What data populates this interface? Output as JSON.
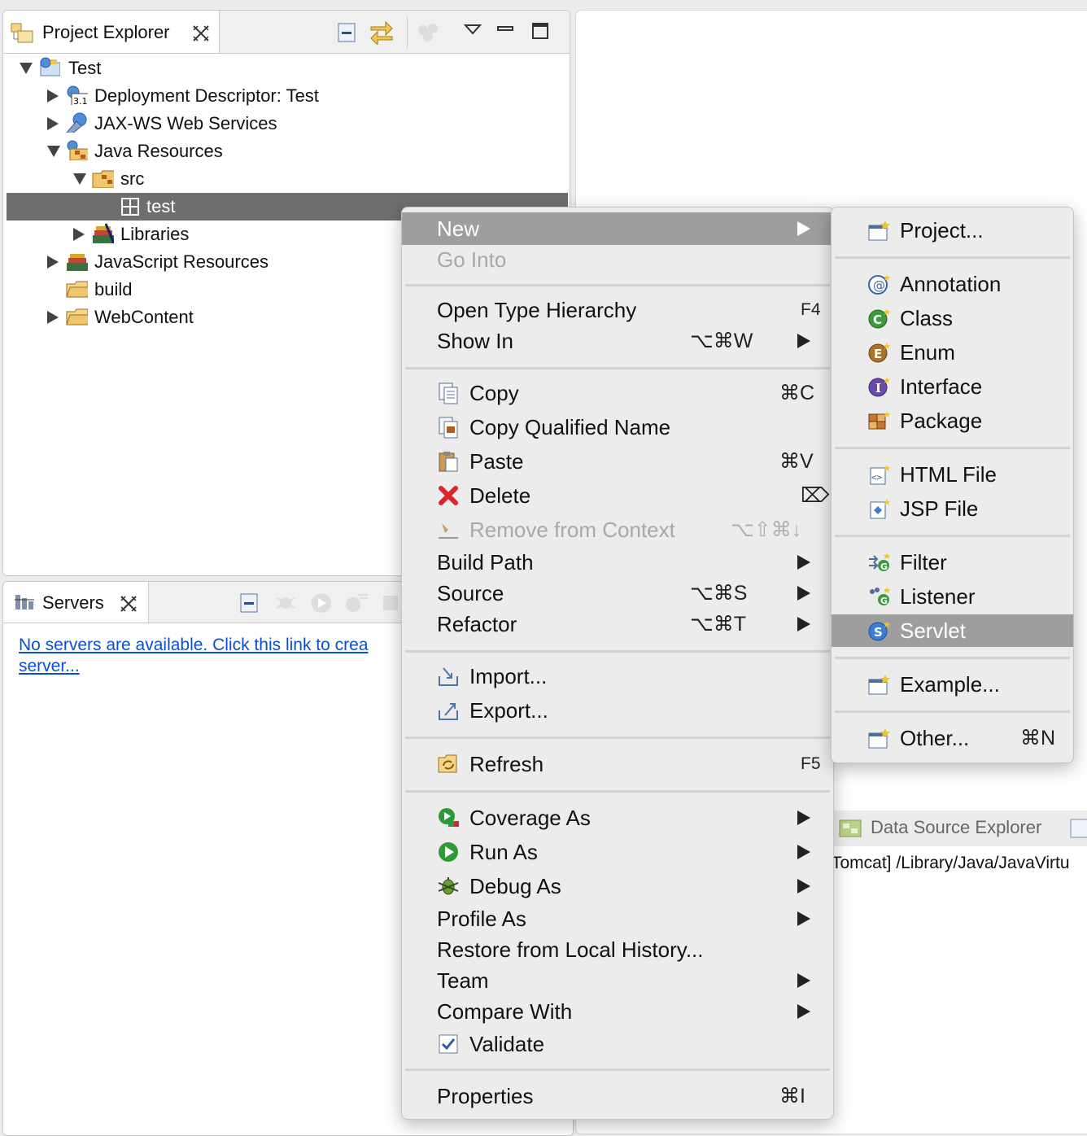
{
  "project_explorer": {
    "tab_title": "Project Explorer",
    "tree": [
      {
        "label": "Test",
        "icon": "web-project-icon",
        "expanded": true
      },
      {
        "label": "Deployment Descriptor: Test",
        "icon": "deployment-descriptor-icon",
        "expanded": false
      },
      {
        "label": "JAX-WS Web Services",
        "icon": "web-services-icon",
        "expanded": false
      },
      {
        "label": "Java Resources",
        "icon": "java-resources-icon",
        "expanded": true
      },
      {
        "label": "src",
        "icon": "source-folder-icon",
        "expanded": true
      },
      {
        "label": "test",
        "icon": "package-icon",
        "selected": true
      },
      {
        "label": "Libraries",
        "icon": "libraries-icon",
        "expanded": false
      },
      {
        "label": "JavaScript Resources",
        "icon": "libraries-icon",
        "expanded": false
      },
      {
        "label": "build",
        "icon": "folder-icon"
      },
      {
        "label": "WebContent",
        "icon": "folder-icon",
        "expanded": false
      }
    ]
  },
  "servers": {
    "tab_title": "Servers",
    "link_line1": "No servers are available. Click this link to crea",
    "link_line2": "server..."
  },
  "data_source": {
    "tab_title": "Data Source Explorer",
    "console_text": "Tomcat] /Library/Java/JavaVirtu"
  },
  "context_menu": {
    "groups": [
      [
        {
          "label": "New",
          "submenu": true,
          "highlighted": true
        },
        {
          "label": "Go Into",
          "disabled": true
        }
      ],
      [
        {
          "label": "Open Type Hierarchy",
          "shortcut": "F4"
        },
        {
          "label": "Show In",
          "shortcut": "⌥⌘W",
          "submenu": true
        }
      ],
      [
        {
          "label": "Copy",
          "shortcut": "⌘C",
          "icon": "copy-icon"
        },
        {
          "label": "Copy Qualified Name",
          "icon": "copy-qualified-icon"
        },
        {
          "label": "Paste",
          "shortcut": "⌘V",
          "icon": "paste-icon"
        },
        {
          "label": "Delete",
          "shortcut": "⌦",
          "icon": "delete-icon"
        },
        {
          "label": "Remove from Context",
          "shortcut": "⌥⇧⌘↓",
          "icon": "remove-context-icon",
          "disabled": true
        },
        {
          "label": "Build Path",
          "submenu": true
        },
        {
          "label": "Source",
          "shortcut": "⌥⌘S",
          "submenu": true
        },
        {
          "label": "Refactor",
          "shortcut": "⌥⌘T",
          "submenu": true
        }
      ],
      [
        {
          "label": "Import...",
          "icon": "import-icon"
        },
        {
          "label": "Export...",
          "icon": "export-icon"
        }
      ],
      [
        {
          "label": "Refresh",
          "shortcut": "F5",
          "icon": "refresh-icon"
        }
      ],
      [
        {
          "label": "Coverage As",
          "submenu": true,
          "icon": "coverage-icon"
        },
        {
          "label": "Run As",
          "submenu": true,
          "icon": "run-icon"
        },
        {
          "label": "Debug As",
          "submenu": true,
          "icon": "debug-icon"
        },
        {
          "label": "Profile As",
          "submenu": true
        },
        {
          "label": "Restore from Local History..."
        },
        {
          "label": "Team",
          "submenu": true
        },
        {
          "label": "Compare With",
          "submenu": true
        },
        {
          "label": "Validate",
          "icon": "validate-checkbox-icon"
        }
      ],
      [
        {
          "label": "Properties",
          "shortcut": "⌘I"
        }
      ]
    ]
  },
  "new_submenu": {
    "groups": [
      [
        {
          "label": "Project...",
          "icon": "new-project-icon"
        }
      ],
      [
        {
          "label": "Annotation",
          "icon": "annotation-icon"
        },
        {
          "label": "Class",
          "icon": "class-icon"
        },
        {
          "label": "Enum",
          "icon": "enum-icon"
        },
        {
          "label": "Interface",
          "icon": "interface-icon"
        },
        {
          "label": "Package",
          "icon": "new-package-icon"
        }
      ],
      [
        {
          "label": "HTML File",
          "icon": "html-file-icon"
        },
        {
          "label": "JSP File",
          "icon": "jsp-file-icon"
        }
      ],
      [
        {
          "label": "Filter",
          "icon": "filter-icon"
        },
        {
          "label": "Listener",
          "icon": "listener-icon"
        },
        {
          "label": "Servlet",
          "icon": "servlet-icon",
          "highlighted": true
        }
      ],
      [
        {
          "label": "Example...",
          "icon": "new-example-icon"
        }
      ],
      [
        {
          "label": "Other...",
          "shortcut": "⌘N",
          "icon": "new-other-icon"
        }
      ]
    ]
  }
}
